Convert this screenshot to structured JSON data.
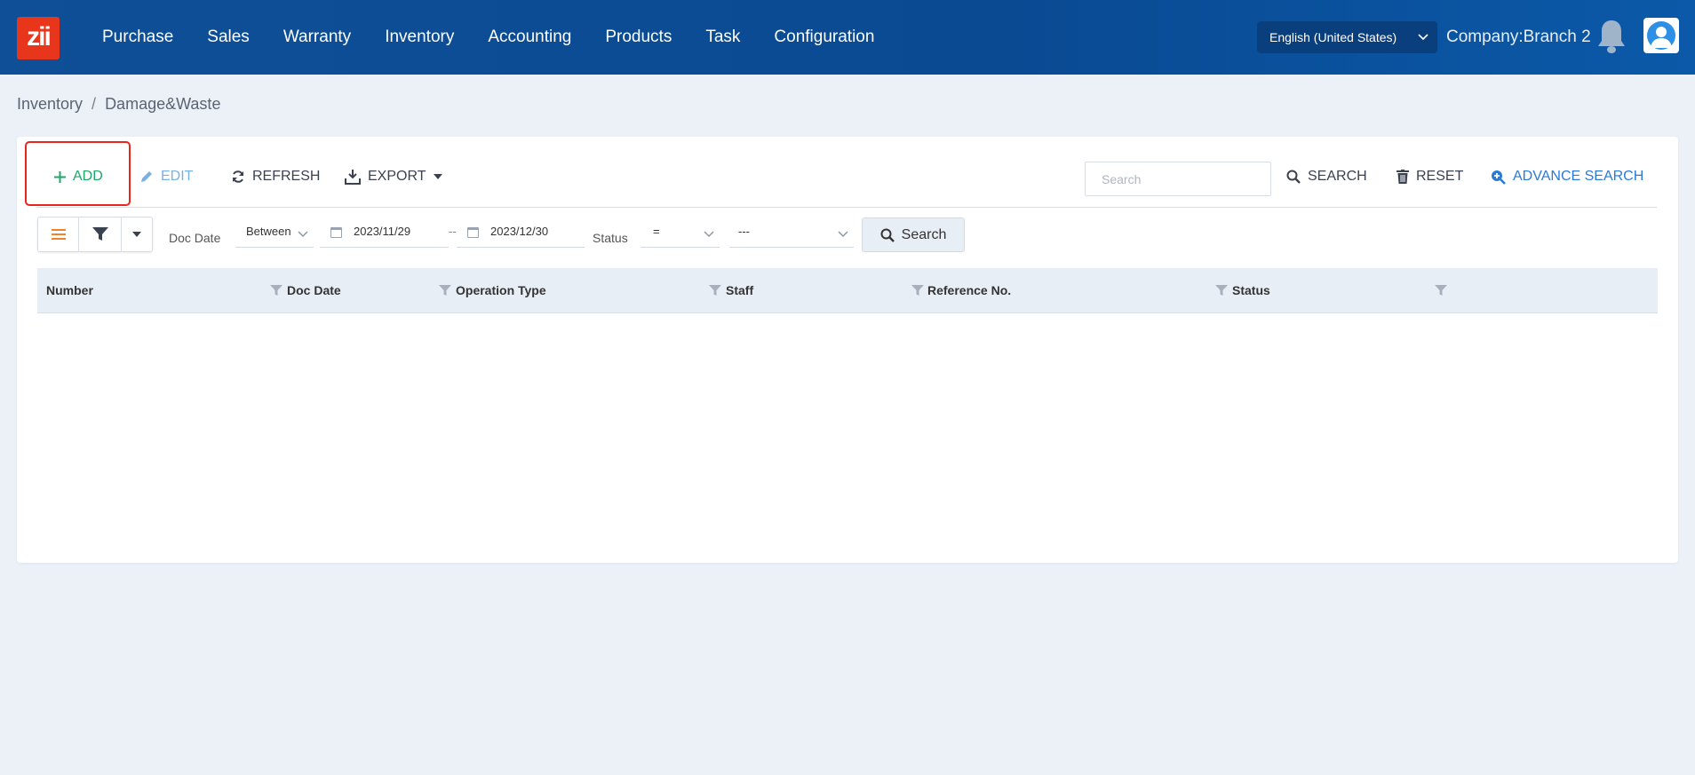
{
  "app": {
    "logo_text": "zii"
  },
  "nav": {
    "items": [
      {
        "label": "Purchase"
      },
      {
        "label": "Sales"
      },
      {
        "label": "Warranty"
      },
      {
        "label": "Inventory"
      },
      {
        "label": "Accounting"
      },
      {
        "label": "Products"
      },
      {
        "label": "Task"
      },
      {
        "label": "Configuration"
      }
    ],
    "language": "English (United States)",
    "company": "Company:Branch 2"
  },
  "breadcrumb": {
    "parent": "Inventory",
    "separator": "/",
    "current": "Damage&Waste"
  },
  "toolbar": {
    "add_label": "ADD",
    "edit_label": "EDIT",
    "refresh_label": "REFRESH",
    "export_label": "EXPORT",
    "search_placeholder": "Search",
    "search_label": "SEARCH",
    "reset_label": "RESET",
    "advance_search_label": "ADVANCE SEARCH"
  },
  "filters": {
    "doc_date_label": "Doc Date",
    "doc_date_operator": "Between",
    "date_from": "2023/11/29",
    "date_separator": "--",
    "date_to": "2023/12/30",
    "status_label": "Status",
    "status_operator": "=",
    "status_value": "---",
    "search_button": "Search"
  },
  "table": {
    "columns": [
      {
        "label": "Number"
      },
      {
        "label": "Doc Date"
      },
      {
        "label": "Operation Type"
      },
      {
        "label": "Staff"
      },
      {
        "label": "Reference No."
      },
      {
        "label": "Status"
      }
    ],
    "rows": []
  },
  "colors": {
    "header_bg": "#0e4f97",
    "add_green": "#1ea86a",
    "accent_blue": "#2a7ad6",
    "logo_red": "#e8361d",
    "highlight_red": "#e8261d",
    "list_icon_orange": "#f0822d"
  }
}
